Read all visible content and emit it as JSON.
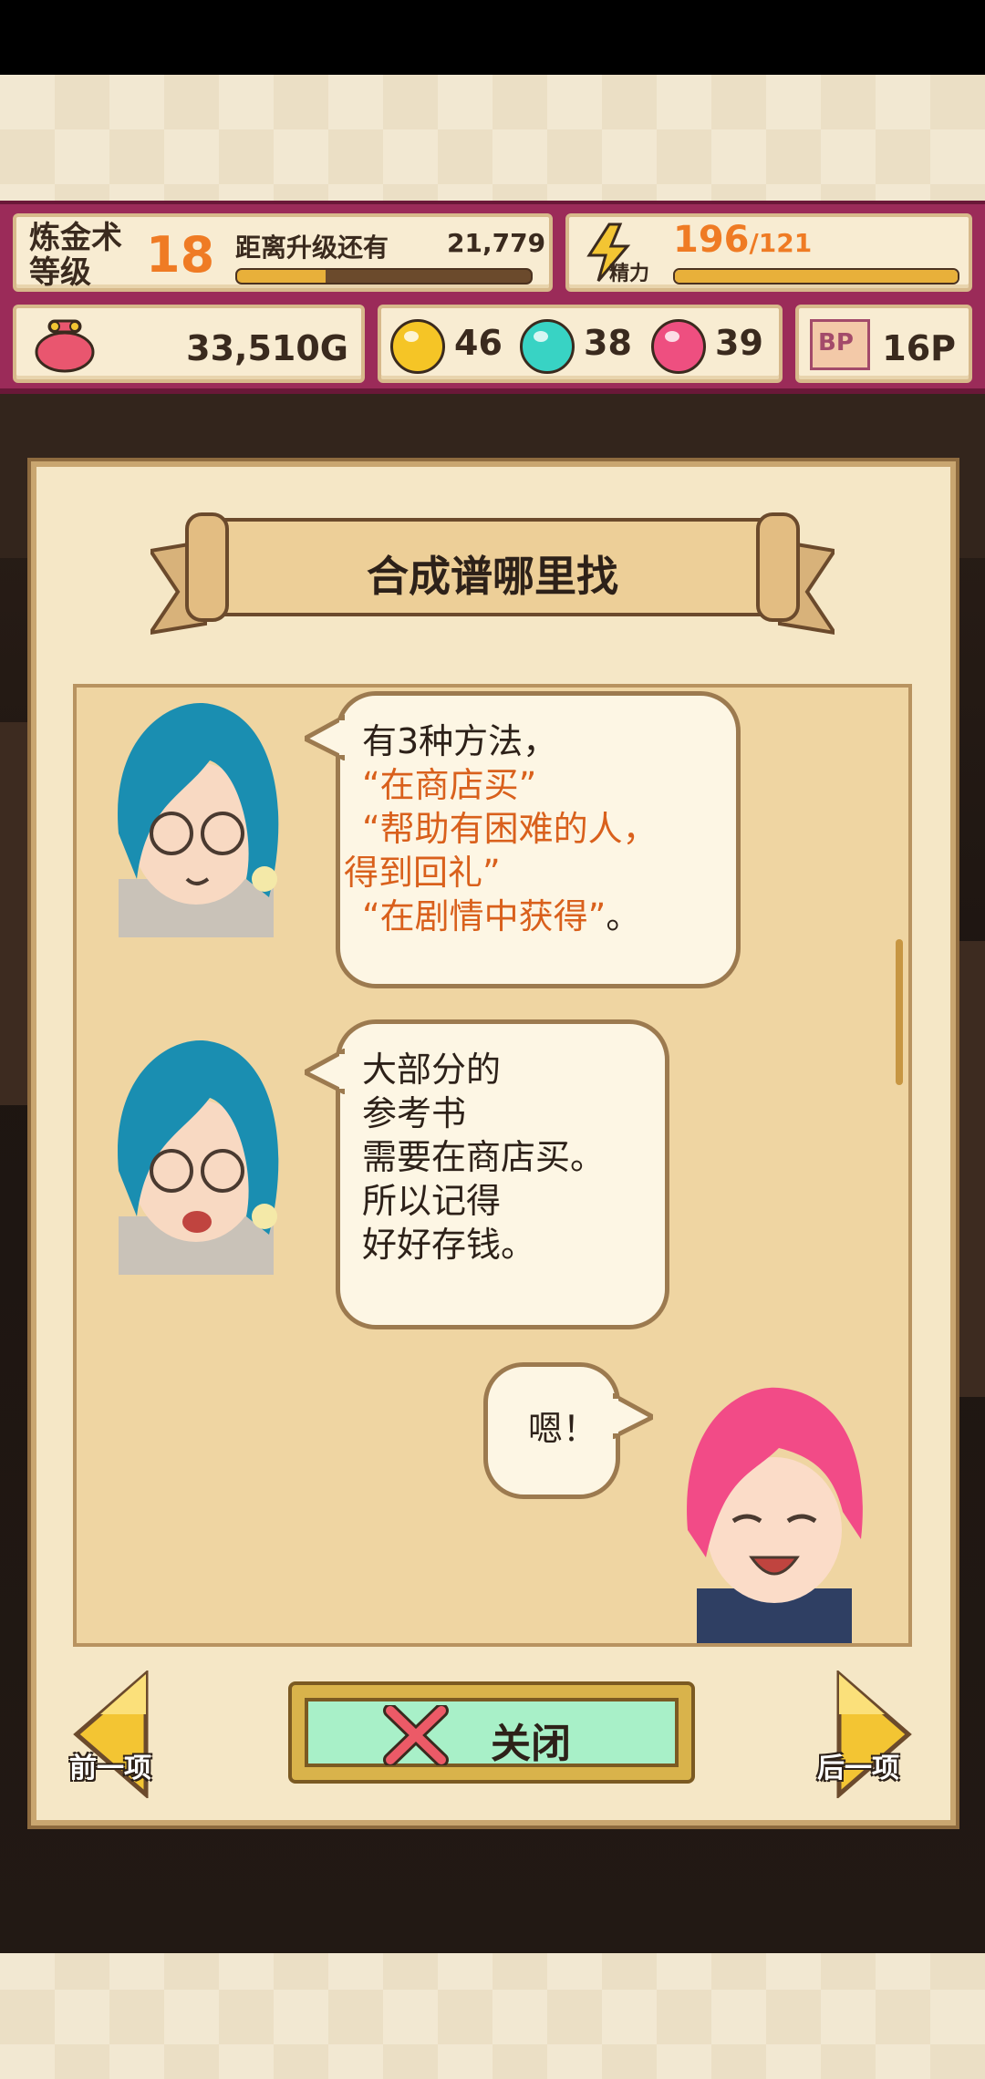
{
  "hud": {
    "level_label_line1": "炼金术",
    "level_label_line2": "等级",
    "level": "18",
    "next_level_label": "距离升级还有",
    "next_level_value": "21,779",
    "next_level_progress": 0.3,
    "energy_icon_label": "精力",
    "energy_current": "196",
    "energy_max": "/121",
    "energy_progress": 1.0,
    "gold": "33,510G",
    "gem_yellow": "46",
    "gem_cyan": "38",
    "gem_pink": "39",
    "bp_icon_label": "BP",
    "bp_value": "16P",
    "colors": {
      "hud_bg": "#9b2b59",
      "accent_orange": "#ef7b24"
    }
  },
  "dialog": {
    "title": "合成谱哪里找",
    "messages": [
      {
        "speaker": "teacher",
        "lines": [
          {
            "text": "有3种方法，",
            "highlight": false
          },
          {
            "text": "“在商店买”",
            "highlight": true
          },
          {
            "text": "“帮助有困难的人，",
            "highlight": true
          },
          {
            "text": "得到回礼”",
            "highlight": true
          },
          {
            "text": "“在剧情中获得”",
            "highlight": true,
            "suffix": "。"
          }
        ]
      },
      {
        "speaker": "teacher",
        "lines": [
          {
            "text": "大部分的",
            "highlight": false
          },
          {
            "text": "参考书",
            "highlight": false
          },
          {
            "text": "需要在商店买。",
            "highlight": false
          },
          {
            "text": "所以记得",
            "highlight": false
          },
          {
            "text": "好好存钱。",
            "highlight": false
          }
        ]
      },
      {
        "speaker": "player",
        "lines": [
          {
            "text": "嗯！",
            "highlight": false
          }
        ]
      }
    ],
    "close_label": "关闭",
    "prev_label": "前一项",
    "next_label": "后一项",
    "colors": {
      "highlight": "#d9601c",
      "close_button": "#a8f0c8"
    }
  }
}
